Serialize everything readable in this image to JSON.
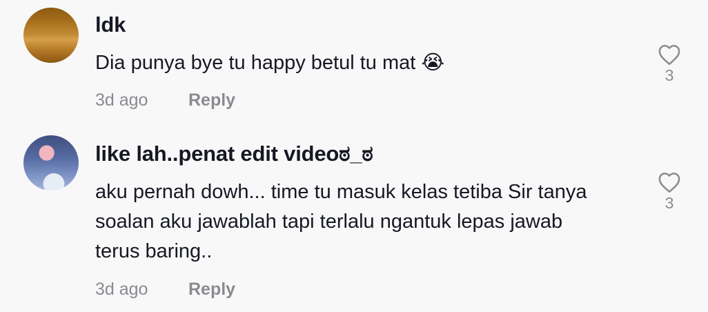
{
  "comments": [
    {
      "username": "ldk",
      "text": "Dia punya bye tu happy betul tu mat 😭",
      "time": "3d ago",
      "reply_label": "Reply",
      "likes": "3"
    },
    {
      "username": "like lah..penat edit videoಠ_ಠ",
      "text": "aku pernah dowh... time tu masuk kelas tetiba Sir tanya\nsoalan aku jawablah tapi terlalu ngantuk lepas jawab\nterus baring..",
      "time": "3d ago",
      "reply_label": "Reply",
      "likes": "3"
    }
  ],
  "icons": {
    "like": "heart-outline-icon"
  },
  "colors": {
    "background": "#f8f8f8",
    "text": "#161823",
    "secondary": "#8a8b91"
  }
}
